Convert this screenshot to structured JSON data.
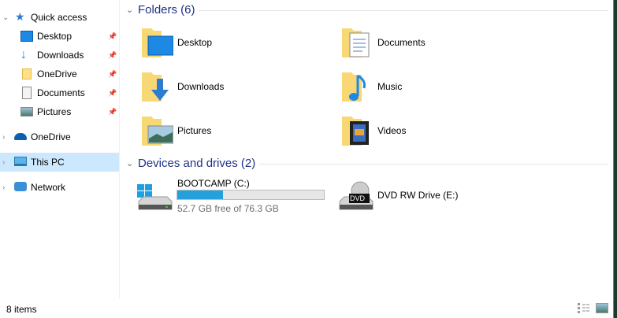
{
  "nav": {
    "quick_access": "Quick access",
    "pinned": [
      {
        "label": "Desktop",
        "icon": "desktop-icon"
      },
      {
        "label": "Downloads",
        "icon": "downloads-icon"
      },
      {
        "label": "OneDrive",
        "icon": "folder-icon"
      },
      {
        "label": "Documents",
        "icon": "documents-icon"
      },
      {
        "label": "Pictures",
        "icon": "pictures-icon"
      }
    ],
    "onedrive": "OneDrive",
    "this_pc": "This PC",
    "network": "Network"
  },
  "folders": {
    "header": "Folders (6)",
    "items": [
      {
        "label": "Desktop"
      },
      {
        "label": "Documents"
      },
      {
        "label": "Downloads"
      },
      {
        "label": "Music"
      },
      {
        "label": "Pictures"
      },
      {
        "label": "Videos"
      }
    ]
  },
  "drives": {
    "header": "Devices and drives (2)",
    "items": [
      {
        "label": "BOOTCAMP (C:)",
        "free": "52.7 GB free of 76.3 GB",
        "used_fraction": 0.31
      },
      {
        "label": "DVD RW Drive (E:)",
        "badge": "DVD"
      }
    ]
  },
  "status": {
    "items": "8 items"
  },
  "colors": {
    "accent": "#26a0da",
    "selection": "#cce8ff",
    "header": "#1e3287"
  }
}
